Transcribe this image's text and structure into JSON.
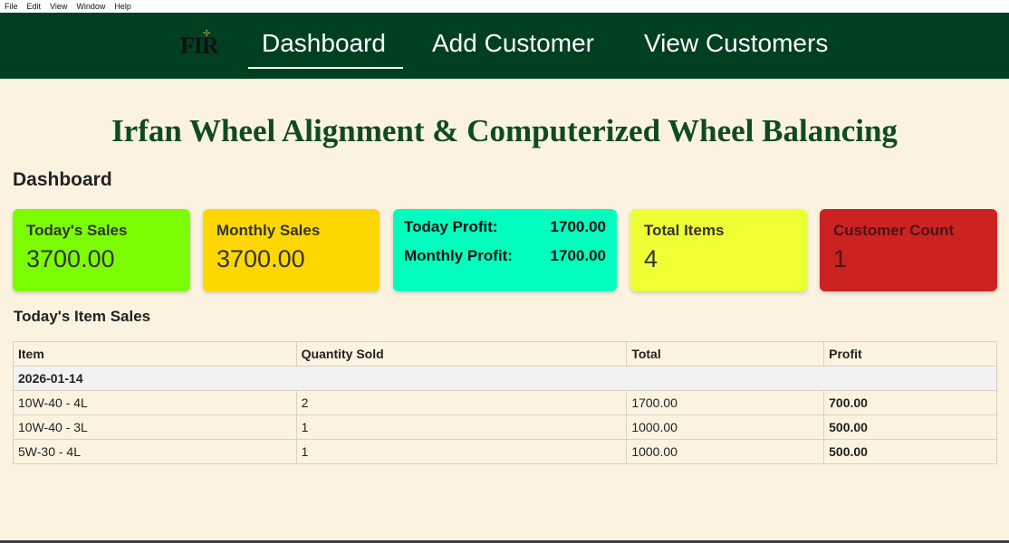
{
  "menubar": {
    "items": [
      "File",
      "Edit",
      "View",
      "Window",
      "Help"
    ]
  },
  "nav": {
    "logo": "FIR",
    "links": [
      "Dashboard",
      "Add Customer",
      "View Customers"
    ],
    "active": "Dashboard"
  },
  "page": {
    "title": "Irfan Wheel Alignment & Computerized Wheel Balancing",
    "section_heading": "Dashboard",
    "table_heading": "Today's Item Sales"
  },
  "cards": {
    "todays_sales": {
      "label": "Today's Sales",
      "value": "3700.00",
      "color": "#7cfc00"
    },
    "monthly_sales": {
      "label": "Monthly Sales",
      "value": "3700.00",
      "color": "#ffd700"
    },
    "profit": {
      "color": "#00ffbf",
      "today_label": "Today Profit:",
      "today_value": "1700.00",
      "monthly_label": "Monthly Profit:",
      "monthly_value": "1700.00"
    },
    "total_items": {
      "label": "Total Items",
      "value": "4",
      "color": "#eeff33"
    },
    "customer_count": {
      "label": "Customer Count",
      "value": "1",
      "color": "#cc2222"
    }
  },
  "table": {
    "headers": [
      "Item",
      "Quantity Sold",
      "Total",
      "Profit"
    ],
    "date_group": "2026-01-14",
    "rows": [
      {
        "item": "10W-40 - 4L",
        "qty": "2",
        "total": "1700.00",
        "profit": "700.00"
      },
      {
        "item": "10W-40 - 3L",
        "qty": "1",
        "total": "1000.00",
        "profit": "500.00"
      },
      {
        "item": "5W-30 - 4L",
        "qty": "1",
        "total": "1000.00",
        "profit": "500.00"
      }
    ]
  },
  "colors": {
    "nav_bg": "#004021",
    "page_bg": "#fbf3e0",
    "title": "#0f4a22"
  }
}
